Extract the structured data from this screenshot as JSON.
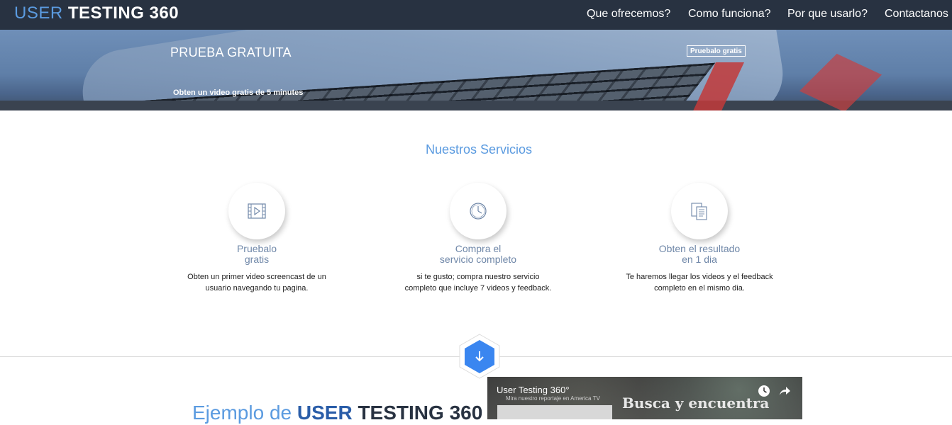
{
  "brand": {
    "logo_light": "USER",
    "logo_bold": "TESTING 360"
  },
  "nav": {
    "items": [
      {
        "label": "Que ofrecemos?"
      },
      {
        "label": "Como funciona?"
      },
      {
        "label": "Por que usarlo?"
      },
      {
        "label": "Contactanos"
      }
    ]
  },
  "hero": {
    "title": "PRUEBA GRATUITA",
    "subtitle": "Obten un video gratis de 5 minutes",
    "button_label": "Pruebalo gratis"
  },
  "services": {
    "heading": "Nuestros Servicios",
    "items": [
      {
        "icon": "video-icon",
        "title_line1": "Pruebalo",
        "title_line2": "gratis",
        "desc_line1": "Obten un primer video screencast de un",
        "desc_line2": "usuario navegando tu pagina."
      },
      {
        "icon": "clock-icon",
        "title_line1": "Compra el",
        "title_line2": "servicio completo",
        "desc_line1": "si te gusto; compra nuestro servicio",
        "desc_line2": "completo que incluye 7 videos y feedback."
      },
      {
        "icon": "documents-icon",
        "title_line1": "Obten el resultado",
        "title_line2": "en 1 dia",
        "desc_line1": "Te haremos llegar los videos y el feedback",
        "desc_line2": "completo en el mismo dia."
      }
    ]
  },
  "scroll_down_icon": "arrow-down-icon",
  "example": {
    "title_pre": "Ejemplo de",
    "title_brand1": "USER",
    "title_brand2": "TESTING 360"
  },
  "video": {
    "title": "User Testing 360°",
    "subtitle": "Mira nuestro reportaje en America TV",
    "overlay_text": "Busca y encuentra",
    "icons": [
      "watch-later-icon",
      "share-icon"
    ]
  },
  "colors": {
    "navbar": "#283241",
    "accent_blue": "#5b9be0",
    "service_title": "#6f87a8",
    "hex_button": "#3a86f0"
  }
}
